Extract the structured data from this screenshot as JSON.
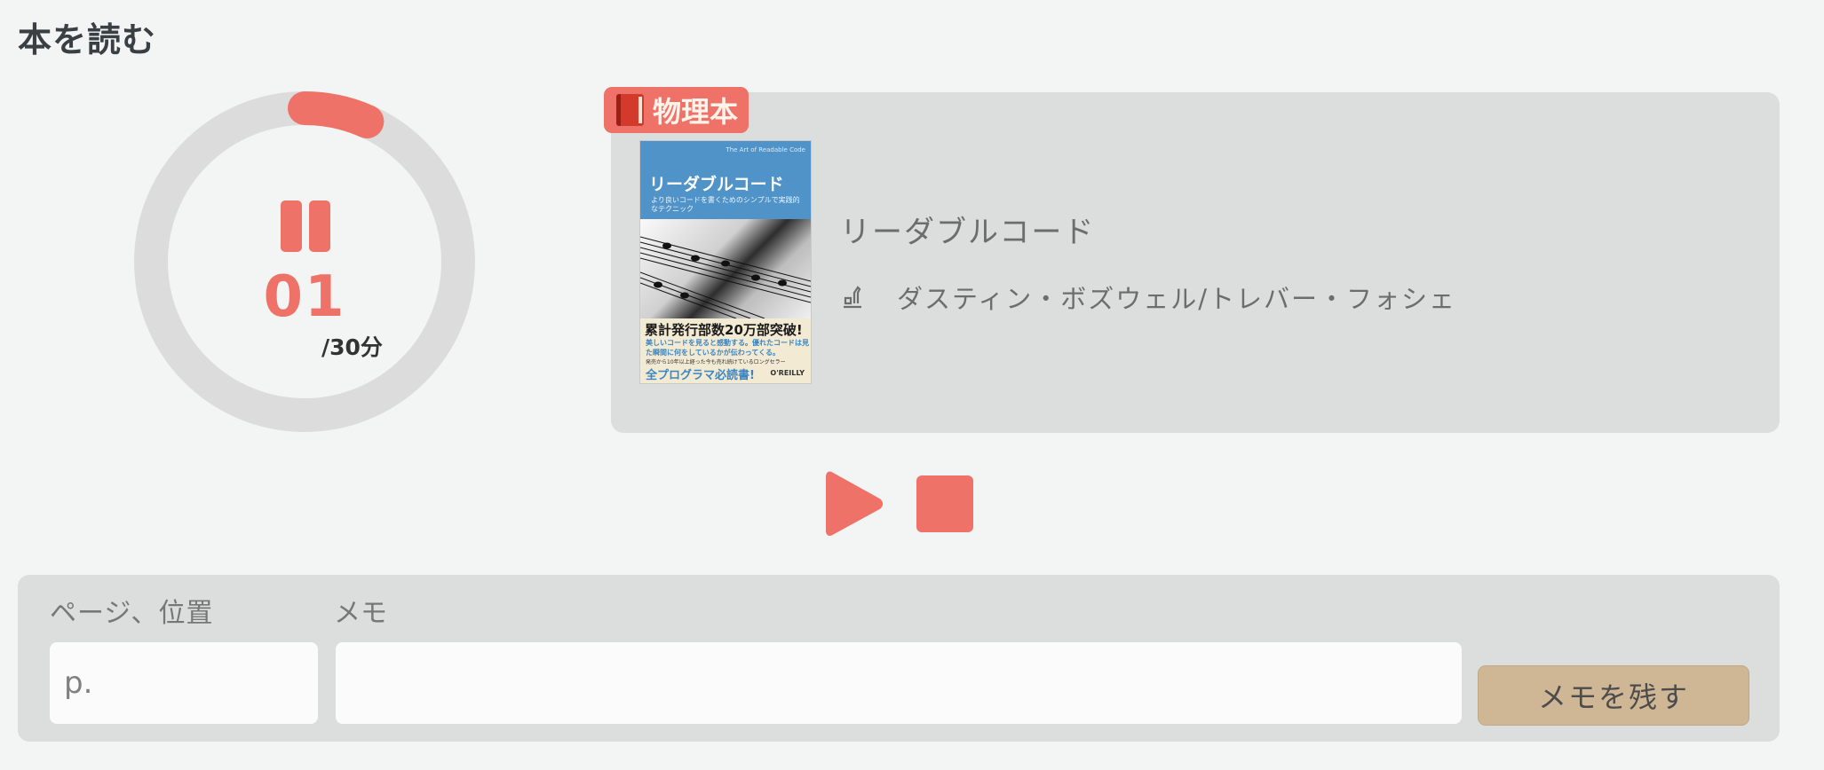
{
  "page": {
    "title": "本を読む"
  },
  "timer": {
    "minutes": "01",
    "total": "/30分",
    "progress_fraction": 0.0667,
    "state": "paused",
    "ring_color": "#dcdcdc",
    "progress_color": "#ef7268",
    "pause_icon": "pause-icon"
  },
  "book": {
    "type_badge": "物理本",
    "type_icon": "book-icon",
    "title": "リーダブルコード",
    "author_icon": "pen-icon",
    "author": "ダスティン・ボズウェル/トレバー・フォシェ",
    "cover": {
      "title": "リーダブルコード",
      "tiny_subtitle": "The Art of Readable Code",
      "subtitle": "より良いコードを書くためのシンプルで実践的なテクニック",
      "headline": "累計発行部数20万部突破!",
      "blurb": "美しいコードを見ると感動する。優れたコードは見た瞬間に何をしているかが伝わってくる。",
      "note": "発売から10年以上経った今も売れ続けているロングセラー",
      "banner": "全プログラマ必読書!",
      "publisher": "O'REILLY"
    }
  },
  "controls": {
    "play_icon": "play-icon",
    "stop_icon": "stop-icon",
    "accent": "#ef7268"
  },
  "memo_form": {
    "page_label": "ページ、位置",
    "page_placeholder": "p.",
    "memo_label": "メモ",
    "memo_value": "",
    "submit_label": "メモを残す",
    "submit_color": "#cfb796"
  }
}
